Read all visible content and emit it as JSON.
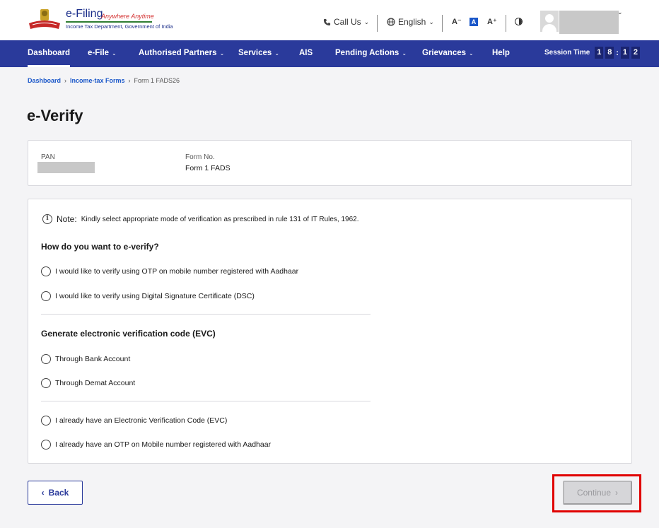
{
  "header": {
    "logo_title": "e-Filing",
    "logo_tagline": "Anywhere Anytime",
    "logo_sub": "Income Tax Department, Government of India",
    "call_us_label": "Call Us",
    "language_label": "English",
    "font_decrease_label": "A⁻",
    "font_normal_label": "A",
    "font_increase_label": "A⁺",
    "icons": {
      "phone": "phone-icon",
      "globe": "globe-icon",
      "contrast": "contrast-icon",
      "user": "user-avatar-icon"
    }
  },
  "nav": {
    "items": [
      {
        "label": "Dashboard",
        "active": true,
        "dropdown": false
      },
      {
        "label": "e-File",
        "active": false,
        "dropdown": true
      },
      {
        "label": "Authorised Partners",
        "active": false,
        "dropdown": true
      },
      {
        "label": "Services",
        "active": false,
        "dropdown": true
      },
      {
        "label": "AIS",
        "active": false,
        "dropdown": false
      },
      {
        "label": "Pending Actions",
        "active": false,
        "dropdown": true
      },
      {
        "label": "Grievances",
        "active": false,
        "dropdown": true
      },
      {
        "label": "Help",
        "active": false,
        "dropdown": false
      }
    ],
    "session_label": "Session Time",
    "session_digits": [
      "1",
      "8",
      "1",
      "2"
    ],
    "session_separator": ":"
  },
  "breadcrumb": {
    "items": [
      "Dashboard",
      "Income-tax Forms"
    ],
    "current": "Form 1 FADS26"
  },
  "page": {
    "title": "e-Verify"
  },
  "info": {
    "pan_label": "PAN",
    "form_no_label": "Form No.",
    "form_no_value": "Form 1 FADS"
  },
  "verify": {
    "note_label": "Note:",
    "note_text": "Kindly select appropriate mode of verification as prescribed in rule 131 of IT Rules, 1962.",
    "question": "How do you want to e-verify?",
    "group1": [
      "I would like to verify using OTP on mobile number registered with Aadhaar",
      "I would like to verify using Digital Signature Certificate (DSC)"
    ],
    "evc_heading": "Generate electronic verification code (EVC)",
    "group2": [
      "Through Bank Account",
      "Through Demat Account"
    ],
    "group3": [
      "I already have an Electronic Verification Code (EVC)",
      "I already have an OTP on Mobile number registered with Aadhaar"
    ]
  },
  "actions": {
    "back_label": "Back",
    "continue_label": "Continue",
    "continue_enabled": false
  },
  "colors": {
    "nav_bg": "#2a3a9b",
    "link": "#1a57c9",
    "highlight": "#e00000",
    "disabled_bg": "#d6d6d9"
  }
}
